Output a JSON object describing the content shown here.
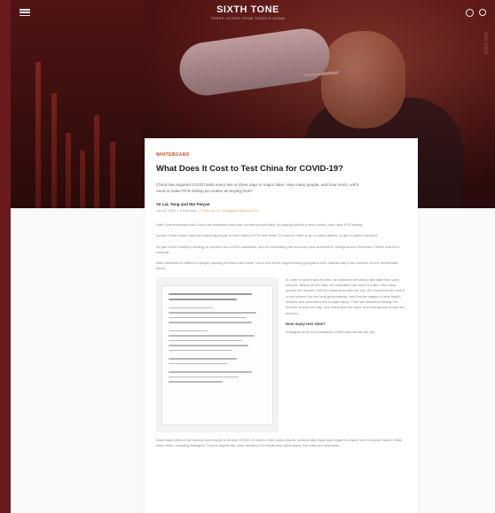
{
  "site": {
    "logo": "SIXTH TONE",
    "tagline": "FRESH VOICES FROM TODAY'S CHINA"
  },
  "hero": {
    "side_label": "Mar 2023"
  },
  "article": {
    "category": "WHITEBOARD",
    "title": "What Does It Cost to Test China for COVID-19?",
    "summary": "China has required COVID tests every two or three days in major cities. How many people, and how much, will it need to make PCR testing as routine as buying food?",
    "author": "Ye Lai, Tang and Wu Peiyue",
    "date": "Jun 08, 2022",
    "read_time": "8 min read",
    "photo_credit": "Photo by Yin / Shanghai Daily via VCG",
    "paragraphs": [
      "Sixth Tone examined how China has estimated how they can test people daily. It's staying behind a new routine: near-daily PCR testing.",
      "Across China, major cities are requiring people to have taken a PCR test within 72 hours in order to go to public places, or get on public transport.",
      "It's part of the country's strategy to prevent new COVID outbreaks, and it's dominating the economy now launched in Shanghai and Shenzhen. Here's how far it could go.",
      "With hundreds of millions of people queuing for tests each week, this is one of the largest testing programs ever: officials say it will continue for the foreseeable future."
    ],
    "side_paragraph": "In order to keep track of cities, we collected the testing site data from open sources. Based on the data, we estimated how much it costs, how many people are needed, and the financial burden per city. We found that the cost is a real concern for the local governments, and that the wages of local health workers and volunteers are a major factor. Then we examined testing: the number of tests per day, how many labs are used, and how quickly results are returned.",
    "subhead": "How many test sites?",
    "after_subhead": "Shanghai alone has thousands of test sites across the city.",
    "closing": "Most major cities in the country now require a 48-hour COVID-19 test to enter public places, several cities have also begun to require one for public transit. While some cities, including Shanghai, China's largest city, have released 15-minute test radius plans, the costs are enormous."
  }
}
